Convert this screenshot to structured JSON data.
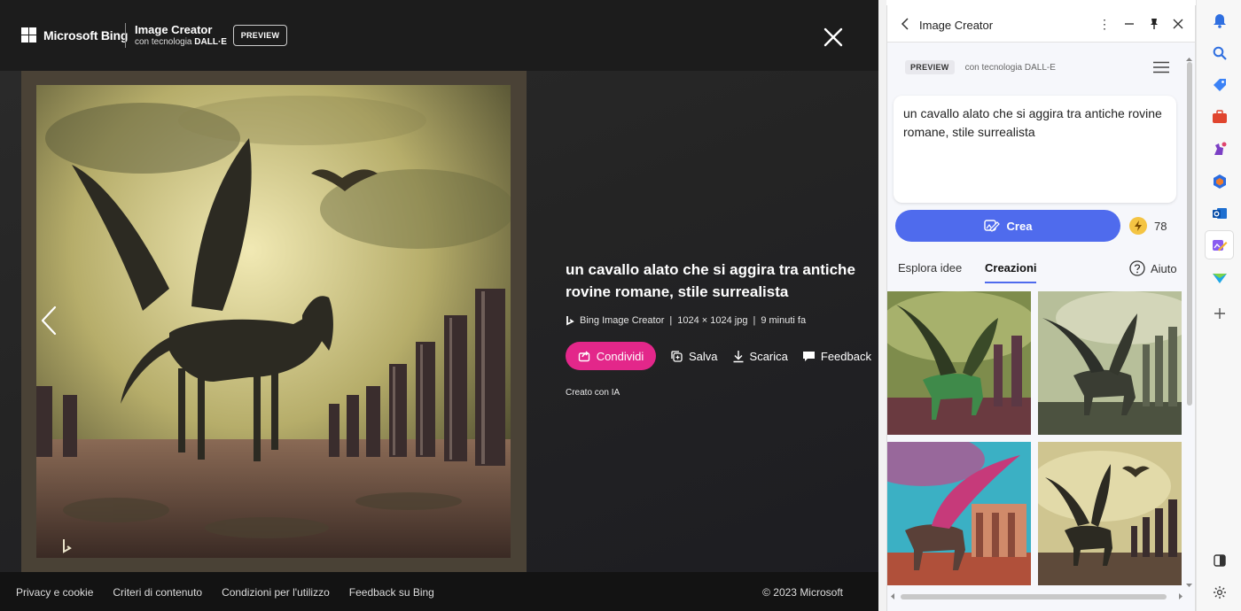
{
  "header": {
    "brand": "Microsoft Bing",
    "product_title": "Image Creator",
    "product_subtitle_prefix": "con tecnologia",
    "product_subtitle_strong": "DALL·E",
    "preview_badge": "PREVIEW",
    "close_icon": "close-icon"
  },
  "detail": {
    "prompt": "un cavallo alato che si aggira tra antiche rovine romane, stile surrealista",
    "meta_source": "Bing Image Creator",
    "meta_sep": "|",
    "meta_size": "1024 × 1024 jpg",
    "meta_time": "9 minuti fa",
    "share_label": "Condividi",
    "save_label": "Salva",
    "download_label": "Scarica",
    "feedback_label": "Feedback",
    "ai_note": "Creato con IA"
  },
  "footer": {
    "links": [
      "Privacy e cookie",
      "Criteri di contenuto",
      "Condizioni per l'utilizzo",
      "Feedback su Bing"
    ],
    "copyright": "© 2023 Microsoft"
  },
  "panel": {
    "title": "Image Creator",
    "preview_badge": "PREVIEW",
    "dalle_text": "con tecnologia DALL-E",
    "prompt_text": "un cavallo alato che si aggira tra antiche rovine romane, stile surrealista",
    "create_label": "Crea",
    "boost_count": "78",
    "tabs": [
      "Esplora idee",
      "Creazioni"
    ],
    "active_tab": "Creazioni",
    "help_label": "Aiuto"
  },
  "colors": {
    "share_button": "#e3278a",
    "create_button": "#4f6bed",
    "boost": "#f4c443"
  }
}
